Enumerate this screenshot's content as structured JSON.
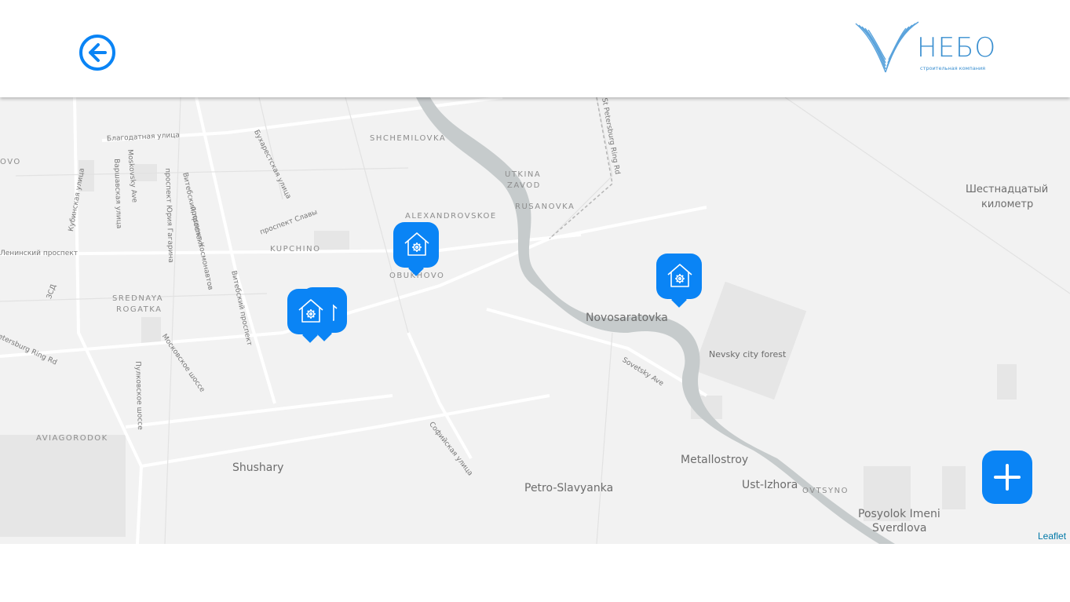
{
  "header": {
    "back_icon": "arrow-left-circle-icon",
    "logo": {
      "name": "НЕБО",
      "tagline": "строительная компания",
      "color": "#3a8fd0"
    }
  },
  "map": {
    "attribution": "Leaflet",
    "labels": {
      "blagodatnaya": "Благодатная улица",
      "shchemilovka": "SHCHEMILOVKA",
      "ovo": "OVO",
      "vitebsky1": "Витебский проспект",
      "bukharestskaya": "Бухарестская улица",
      "utkina": "UTKINA",
      "zavod": "ZAVOD",
      "ring": "St Petersburg Ring Rd",
      "shestnadtsaty": "Шестнадцатый",
      "kilometr": "километр",
      "kubinskaya": "Кубинская улица",
      "moskovsky": "Moskovsky Ave",
      "varshavskaya": "Варшавская улица",
      "gagarina": "проспект Юрия Гагарина",
      "alexandrovskoe": "ALEXANDROVSKOE",
      "rusanovka": "RUSANOVKA",
      "slavy": "проспект Славы",
      "kosmonavtov": "проспект Космонавтов",
      "kupchino": "KUPCHINO",
      "leninsky": "Ленинский проспект",
      "obukhovo": "OBUKHOVO",
      "zsd": "ЗСД",
      "srednaya": "SREDNAYA",
      "rogatka": "ROGATKA",
      "vitebsky2": "Витебский проспект",
      "novosaratovka": "Novosaratovka",
      "nevsky_forest": "Nevsky city forest",
      "ring_rd": "etersburg Ring Rd",
      "moskovskoe": "Московское шоссе",
      "sovetsky": "Sovetsky Ave",
      "pulkovskoe": "Пулковское шоссе",
      "aviagorodok": "AVIAGORODOK",
      "sofiyskaya": "Софийская улица",
      "shushary": "Shushary",
      "metallostroy": "Metallostroy",
      "petro": "Petro-Slavyanka",
      "ust_izhora": "Ust-Izhora",
      "ovtsyno": "OVTSYNO",
      "posyolok": "Posyolok Imeni",
      "sverdlova": "Sverdlova"
    },
    "markers": [
      {
        "name": "marker-kupchino-1",
        "icon": "house-gear-icon"
      },
      {
        "name": "marker-kupchino-2",
        "icon": "house-gear-icon"
      },
      {
        "name": "marker-obukhovo",
        "icon": "house-gear-icon"
      },
      {
        "name": "marker-novosaratovka",
        "icon": "house-gear-icon"
      }
    ],
    "add_button_icon": "plus-icon",
    "accent_color": "#0a84f5"
  }
}
